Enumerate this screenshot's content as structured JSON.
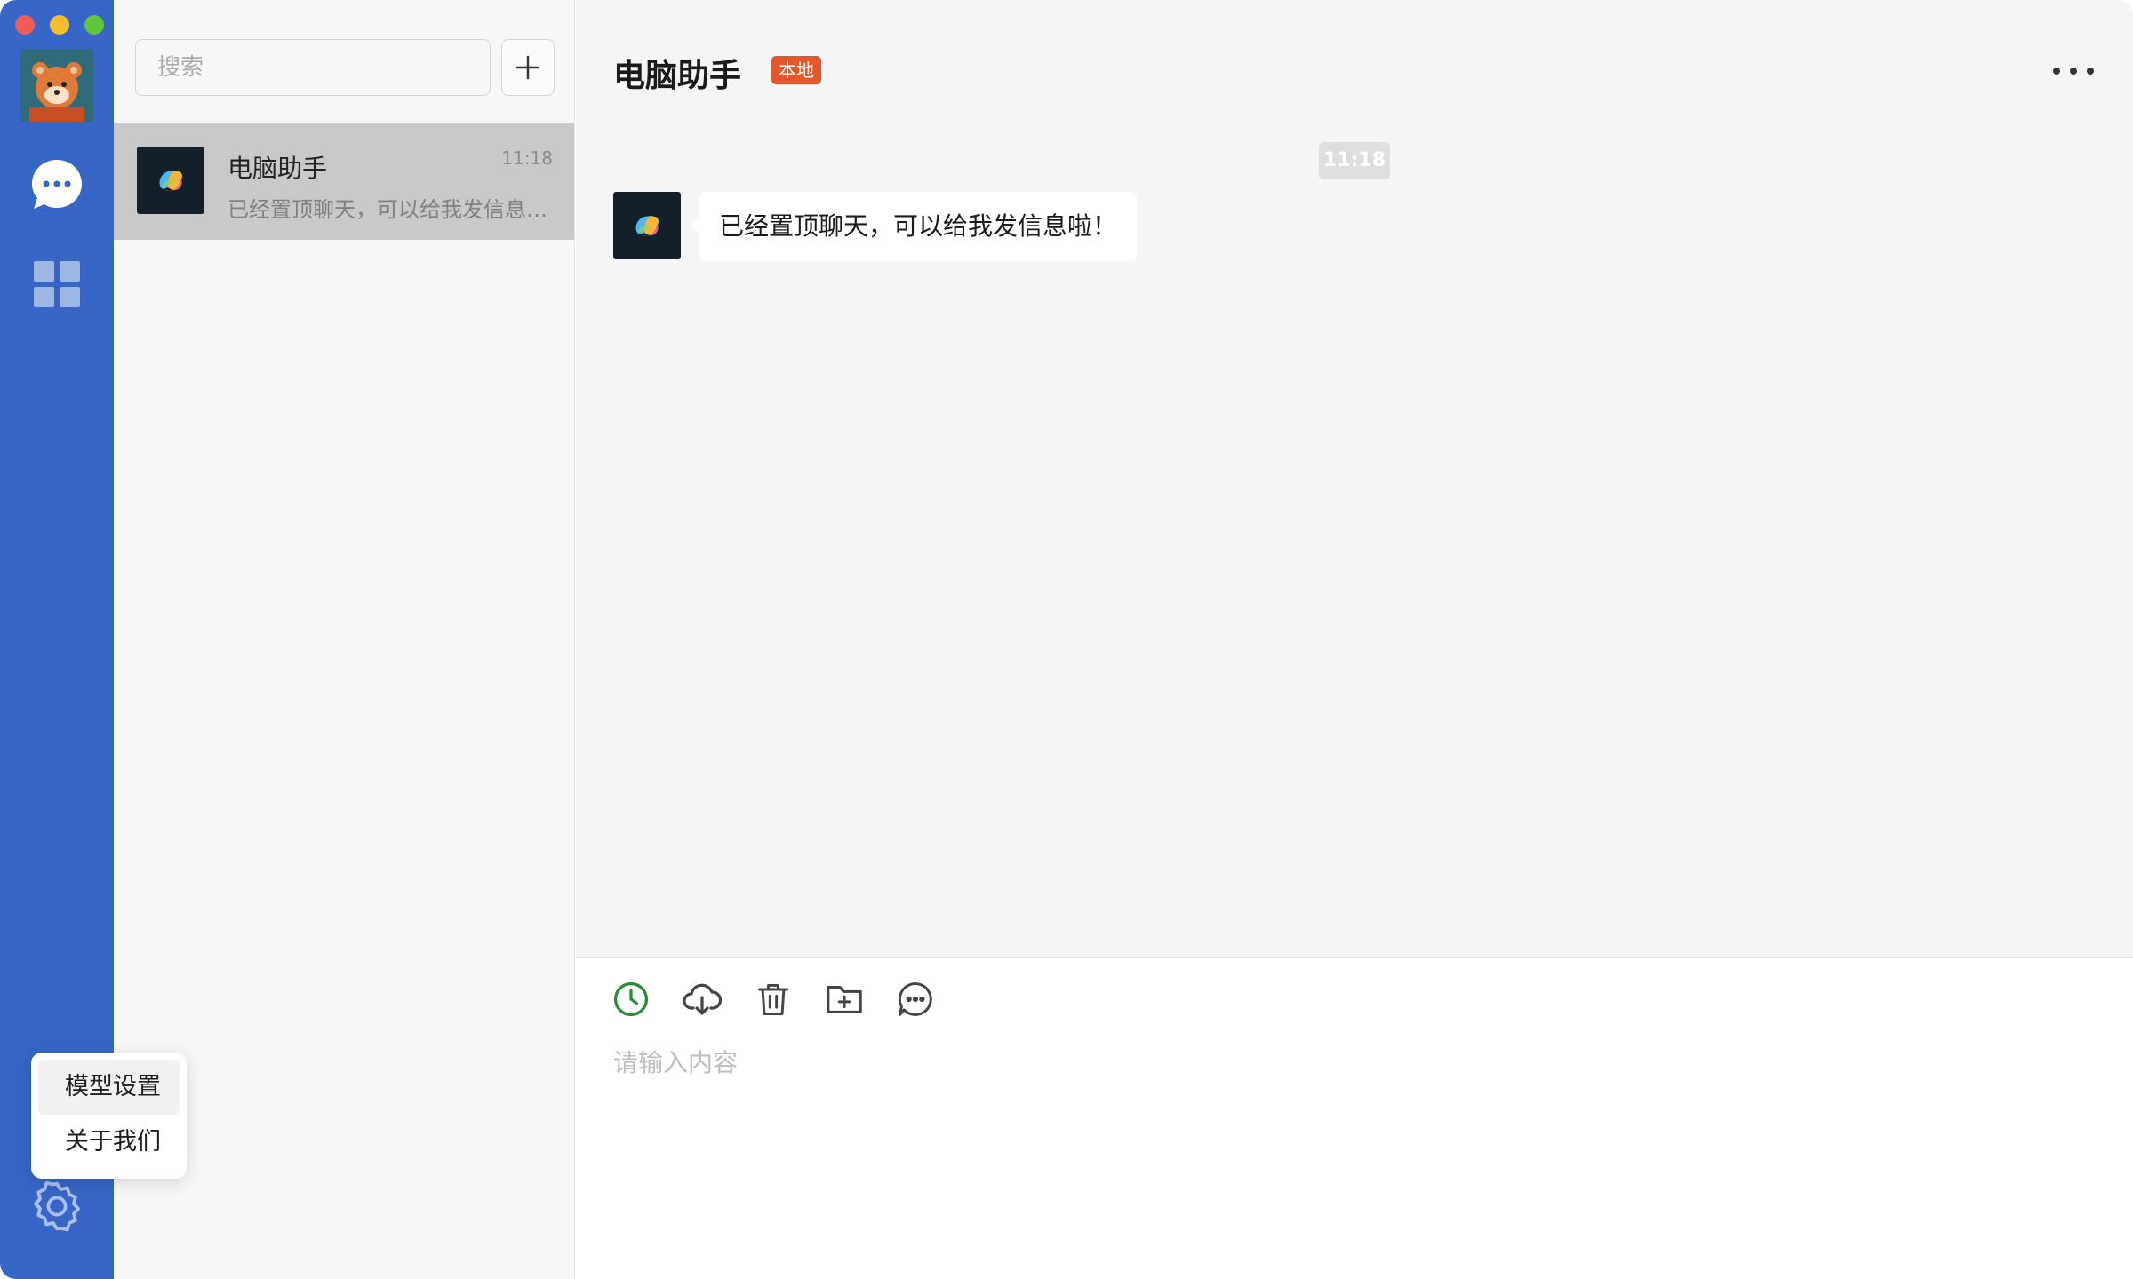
{
  "window": {
    "controls": [
      "close",
      "minimize",
      "maximize"
    ]
  },
  "rail": {
    "items": [
      {
        "name": "chat-icon"
      },
      {
        "name": "apps-icon"
      },
      {
        "name": "gear-icon"
      }
    ],
    "accent": "#3766c7"
  },
  "popup": {
    "items": [
      {
        "label": "模型设置"
      },
      {
        "label": "关于我们"
      }
    ]
  },
  "list": {
    "search_placeholder": "搜索",
    "add_icon": "plus-icon",
    "conversations": [
      {
        "name": "电脑助手",
        "time": "11:18",
        "preview": "已经置顶聊天，可以给我发信息啦！"
      }
    ]
  },
  "chat": {
    "title": "电脑助手",
    "badge": "本地",
    "badge_color": "#e4572a",
    "timestamp": "11:18",
    "messages": [
      {
        "text": "已经置顶聊天，可以给我发信息啦！"
      }
    ]
  },
  "composer": {
    "tools": [
      "history-icon",
      "cloud-download-icon",
      "trash-icon",
      "folder-add-icon",
      "chat-bubble-icon"
    ],
    "placeholder": "请输入内容"
  }
}
